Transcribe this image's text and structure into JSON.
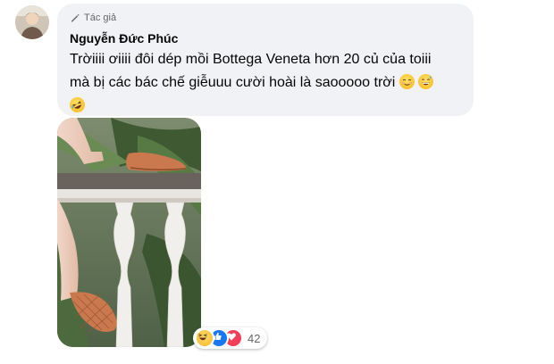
{
  "comment": {
    "badge_label": "Tác giả",
    "author_name": "Nguyễn Đức Phúc",
    "line1": "Trờiiii ơiiii đôi dép mồi Bottega Veneta hơn 20 củ của toiii",
    "line2": "mà bị các bác chế giễuuu cười hoài là saooooo trời",
    "reactions_count": "42",
    "reactions": [
      "haha-icon",
      "like-icon",
      "love-icon"
    ],
    "emojis": [
      "relieved-emoji",
      "grinning-sweat-emoji",
      "rofl-emoji"
    ]
  },
  "colors": {
    "bubble": "#f0f2f5",
    "author_text": "#050505",
    "meta_text": "#65676b",
    "like_blue": "#1877f2",
    "love_red": "#f33e58"
  }
}
